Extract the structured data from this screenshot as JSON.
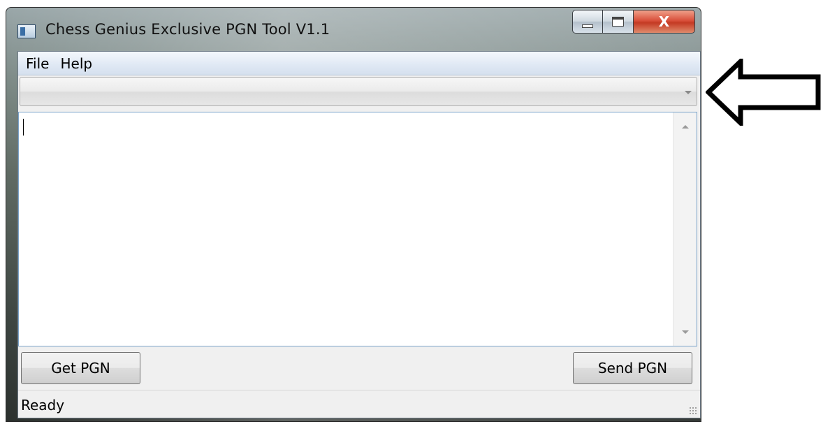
{
  "window": {
    "title": "Chess Genius Exclusive PGN Tool V1.1",
    "close_glyph": "X"
  },
  "menu": {
    "items": [
      "File",
      "Help"
    ]
  },
  "device_combo": {
    "value": ""
  },
  "pgn_editor": {
    "text": ""
  },
  "buttons": {
    "get_pgn": "Get PGN",
    "send_pgn": "Send PGN"
  },
  "status": {
    "text": "Ready"
  },
  "icons": {
    "app": "chess-app-icon",
    "minimize": "minimize-icon",
    "maximize": "maximize-icon",
    "close": "close-icon",
    "combo_arrow": "chevron-down-icon",
    "scroll_up": "scroll-up-icon",
    "scroll_down": "scroll-down-icon",
    "grip": "resize-grip-icon",
    "callout": "left-arrow-icon"
  },
  "colors": {
    "close_button": "#c43a23",
    "menubar": "#dfe8f4",
    "editor_border": "#7aa3c9"
  }
}
